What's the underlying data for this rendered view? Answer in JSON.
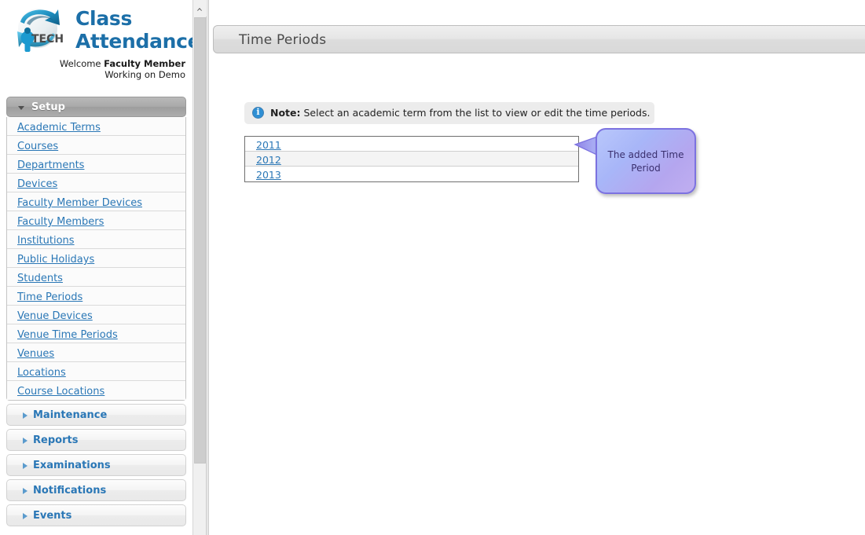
{
  "brand": {
    "logo_icon": "iptech-globe-logo",
    "logo_wordmark": "ipTECH",
    "title_line1": "Class",
    "title_line2": "Attendance",
    "welcome_prefix": "Welcome ",
    "welcome_user": "Faculty Member",
    "working_on": "Working on Demo"
  },
  "sidebar": {
    "setup": {
      "label": "Setup",
      "expanded": true,
      "toggle_icon": "chevron-down-icon",
      "items": [
        {
          "label": "Academic Terms"
        },
        {
          "label": "Courses"
        },
        {
          "label": "Departments"
        },
        {
          "label": "Devices"
        },
        {
          "label": "Faculty Member Devices"
        },
        {
          "label": "Faculty Members"
        },
        {
          "label": "Institutions"
        },
        {
          "label": "Public Holidays"
        },
        {
          "label": "Students"
        },
        {
          "label": "Time Periods"
        },
        {
          "label": "Venue Devices"
        },
        {
          "label": "Venue Time Periods"
        },
        {
          "label": "Venues"
        },
        {
          "label": "Locations"
        },
        {
          "label": "Course Locations"
        }
      ]
    },
    "collapsed_sections": [
      {
        "label": "Maintenance",
        "toggle_icon": "chevron-right-icon"
      },
      {
        "label": "Reports",
        "toggle_icon": "chevron-right-icon"
      },
      {
        "label": "Examinations",
        "toggle_icon": "chevron-right-icon"
      },
      {
        "label": "Notifications",
        "toggle_icon": "chevron-right-icon"
      },
      {
        "label": "Events",
        "toggle_icon": "chevron-right-icon"
      }
    ]
  },
  "scrollbar": {
    "up_arrow_icon": "chevron-up-icon"
  },
  "main": {
    "page_title": "Time Periods",
    "note": {
      "icon": "info-icon",
      "label": "Note:",
      "text": " Select an academic term from the list to view or edit the time periods."
    },
    "terms_list": [
      {
        "label": "2011"
      },
      {
        "label": "2012"
      },
      {
        "label": "2013"
      }
    ],
    "callout": {
      "text": "The added Time Period"
    }
  },
  "colors": {
    "link": "#2a77b6",
    "brand": "#1C6FA8",
    "info": "#2e8fd4",
    "callout_border": "#7c72e0"
  }
}
